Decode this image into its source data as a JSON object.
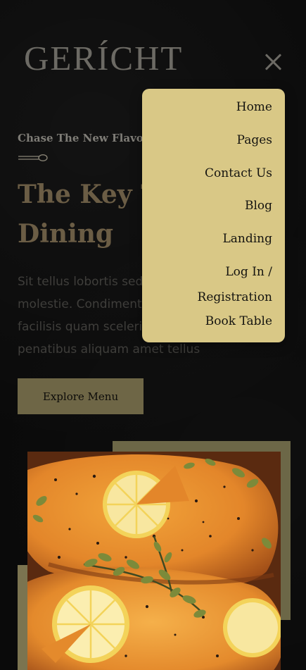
{
  "header": {
    "logo": "GERÍCHT",
    "close_icon": "close-icon"
  },
  "hero": {
    "subtitle": "Chase The New Flavour",
    "spoon_icon": "spoon-icon",
    "headline_line1": "The Key To Fine",
    "headline_line2": "Dining",
    "body": "Sit tellus lobortis sed senectus vivamus molestie. Condimentum volutpat morbi facilisis quam scelerisque sapien. Et, penatibus aliquam amet tellus",
    "cta_label": "Explore Menu"
  },
  "food_image": {
    "subject": "salmon fillets with lemon slices and oregano"
  },
  "nav_menu": {
    "items": [
      {
        "label": "Home"
      },
      {
        "label": "Pages"
      },
      {
        "label": "Contact Us"
      },
      {
        "label": "Blog"
      },
      {
        "label": "Landing"
      },
      {
        "label": "Log In / Registration"
      },
      {
        "label": "Book Table"
      }
    ]
  },
  "colors": {
    "background": "#0a0a0a",
    "gold_accent": "#d9c886",
    "muted_gold": "#6e6646",
    "logo_grey": "#6c6a64"
  }
}
